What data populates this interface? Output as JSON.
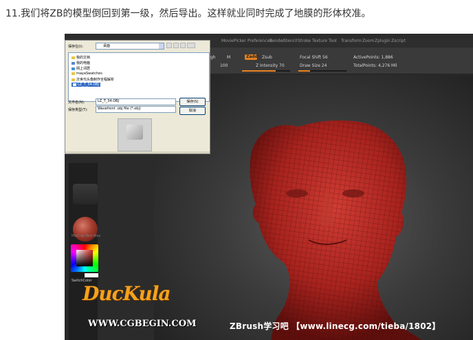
{
  "caption": "11.我们将ZB的模型倒回到第一级，然后导出。这样就业同时完成了地膜的形体校准。",
  "zbrush": {
    "menu": [
      "Movie",
      "Picker",
      "Preferences",
      "Render",
      "Stencil",
      "Stroke",
      "Texture",
      "Tool",
      "Transform",
      "Zoom",
      "Zplugin",
      "Zscript"
    ],
    "topbar": {
      "zadd": "Zadd",
      "zsub": "Zsub",
      "focal_shift": "Focal Shift 56",
      "active_points": "ActivePoints: 1,886",
      "z_intensity": "Z Intensity 70",
      "draw_size": "Draw Size 24",
      "total_points": "TotalPoints: 4,276 Mil",
      "rgb_intensity": "100",
      "rgb_label": "gh",
      "m_label": "M"
    },
    "material_label": "MatCap Red Wax",
    "switch_color_label": "SwitchColor",
    "watermark": "ZBrush学习吧 【www.linecg.com/tieba/1802】"
  },
  "dialog": {
    "save_in_label": "保存在(I):",
    "save_in_value": "桌面",
    "files": [
      {
        "name": "我的文档",
        "icon": "folder-icon"
      },
      {
        "name": "我的电脑",
        "icon": "computer-icon"
      },
      {
        "name": "网上邻居",
        "icon": "network-icon"
      },
      {
        "name": "mayaSwatches",
        "icon": "folder-icon"
      },
      {
        "name": "次世代头像制作全程解析",
        "icon": "folder-icon"
      },
      {
        "name": "LZ_T_34.OBJ",
        "icon": "file-icon"
      }
    ],
    "filename_label": "文件名(N):",
    "filename_value": "LZ_T_34.OBJ",
    "filetype_label": "保存类型(T):",
    "filetype_value": "Wavefront .obj file (*.obj)",
    "save_button": "保存(S)",
    "cancel_button": "取消"
  },
  "logo": {
    "title": "DucKula",
    "url": "WWW.CGBEGIN.COM"
  },
  "colors": {
    "accent_orange": "#e8821e",
    "head_red": "#b52a24",
    "logo_orange": "#f5a21b",
    "selection_blue": "#316ac5"
  }
}
